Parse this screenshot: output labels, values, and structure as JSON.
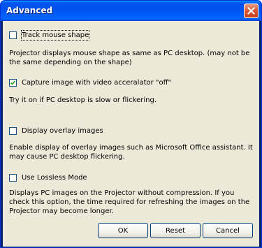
{
  "window": {
    "title": "Advanced",
    "accent_color": "#0053ee",
    "close_color": "#d85a34"
  },
  "options": [
    {
      "label": "Track mouse shape",
      "checked": false,
      "description": "Projector displays mouse shape as same as PC desktop. (may not be the same depending on the shape)"
    },
    {
      "label": "Capture image with video acceralator \"off\"",
      "checked": true,
      "description": "Try it on if PC desktop is slow or flickering."
    },
    {
      "label": "Display overlay images",
      "checked": false,
      "description": "Enable display of overlay images such as Microsoft Office assistant. It may cause PC desktop flickering."
    },
    {
      "label": "Use Lossless Mode",
      "checked": false,
      "description": "Displays PC images on the Projector without compression. If you check this option, the time required for refreshing the images on the Projector may become longer."
    }
  ],
  "buttons": {
    "ok_label": "OK",
    "reset_label": "Reset",
    "cancel_label": "Cancel"
  }
}
